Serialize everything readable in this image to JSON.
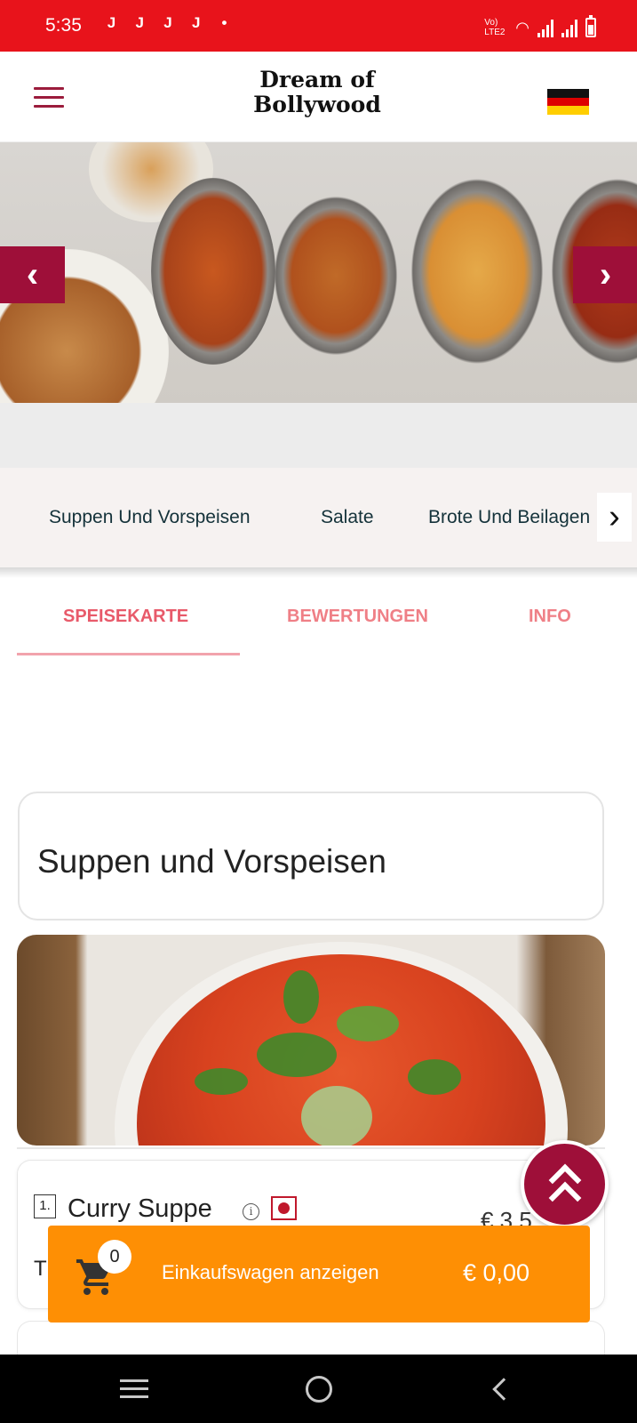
{
  "status_bar": {
    "time": "5:35",
    "notification_glyphs": [
      "J",
      "J",
      "J",
      "J",
      "•"
    ],
    "network_label": "Vo) LTE2"
  },
  "header": {
    "logo_text": "Dream of Bollywood",
    "language": "Deutsch"
  },
  "categories": [
    "Suppen Und Vorspeisen",
    "Salate",
    "Brote Und Beilagen"
  ],
  "tabs": [
    {
      "label": "SPEISEKARTE",
      "active": true
    },
    {
      "label": "BEWERTUNGEN",
      "active": false
    },
    {
      "label": "INFO",
      "active": false
    }
  ],
  "section": {
    "title": "Suppen und Vorspeisen"
  },
  "item": {
    "number": "1.",
    "name": "Curry Suppe",
    "price": "€ 3,5",
    "description_visible": "T"
  },
  "cart": {
    "count": "0",
    "label": "Einkaufswagen anzeigen",
    "total": "€ 0,00"
  },
  "colors": {
    "primary": "#9e0f39",
    "statusbar": "#e8131b",
    "cart": "#fe8f04",
    "tab_active": "#e85a6a",
    "tab": "#ef7f86"
  },
  "icons": [
    "menu-icon",
    "germany-flag-icon",
    "chevron-left-icon",
    "chevron-right-icon",
    "info-icon",
    "vegetarian-icon",
    "double-chevron-up-icon",
    "shopping-cart-icon",
    "recent-apps-icon",
    "home-icon",
    "back-icon"
  ]
}
